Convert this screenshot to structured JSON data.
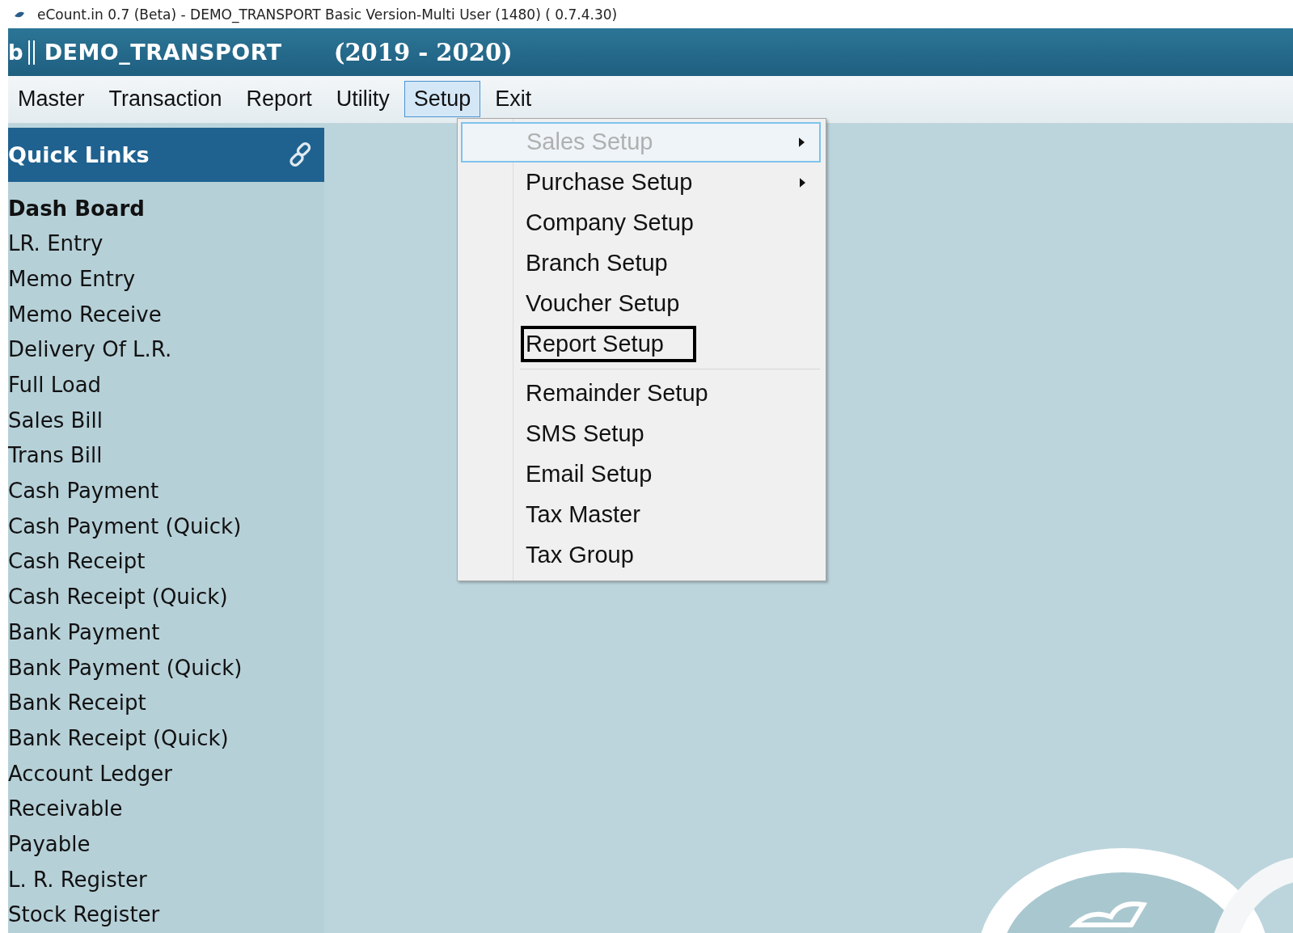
{
  "window": {
    "title": "eCount.in 0.7 (Beta) - DEMO_TRANSPORT Basic Version-Multi User (1480) ( 0.7.4.30)"
  },
  "header": {
    "prefix": "b",
    "company": "DEMO_TRANSPORT",
    "year": "(2019 - 2020)"
  },
  "menu_bar": [
    {
      "label": "Master",
      "selected": false
    },
    {
      "label": "Transaction",
      "selected": false
    },
    {
      "label": "Report",
      "selected": false
    },
    {
      "label": "Utility",
      "selected": false
    },
    {
      "label": "Setup",
      "selected": true
    },
    {
      "label": "Exit",
      "selected": false
    }
  ],
  "setup_menu": [
    {
      "label": "Sales Setup",
      "disabled": true,
      "selected": true,
      "submenu": true,
      "boxed": false,
      "separator_after": false
    },
    {
      "label": "Purchase Setup",
      "disabled": false,
      "selected": false,
      "submenu": true,
      "boxed": false,
      "separator_after": false
    },
    {
      "label": "Company Setup",
      "disabled": false,
      "selected": false,
      "submenu": false,
      "boxed": false,
      "separator_after": false
    },
    {
      "label": "Branch Setup",
      "disabled": false,
      "selected": false,
      "submenu": false,
      "boxed": false,
      "separator_after": false
    },
    {
      "label": "Voucher Setup",
      "disabled": false,
      "selected": false,
      "submenu": false,
      "boxed": false,
      "separator_after": false
    },
    {
      "label": "Report Setup",
      "disabled": false,
      "selected": false,
      "submenu": false,
      "boxed": true,
      "separator_after": true
    },
    {
      "label": "Remainder Setup",
      "disabled": false,
      "selected": false,
      "submenu": false,
      "boxed": false,
      "separator_after": false
    },
    {
      "label": "SMS Setup",
      "disabled": false,
      "selected": false,
      "submenu": false,
      "boxed": false,
      "separator_after": false
    },
    {
      "label": "Email Setup",
      "disabled": false,
      "selected": false,
      "submenu": false,
      "boxed": false,
      "separator_after": false
    },
    {
      "label": "Tax Master",
      "disabled": false,
      "selected": false,
      "submenu": false,
      "boxed": false,
      "separator_after": false
    },
    {
      "label": "Tax Group",
      "disabled": false,
      "selected": false,
      "submenu": false,
      "boxed": false,
      "separator_after": false
    }
  ],
  "quick_links": {
    "title": "Quick Links",
    "items": [
      {
        "label": "Dash Board",
        "selected": true
      },
      {
        "label": "LR. Entry",
        "selected": false
      },
      {
        "label": "Memo Entry",
        "selected": false
      },
      {
        "label": "Memo Receive",
        "selected": false
      },
      {
        "label": "Delivery Of L.R.",
        "selected": false
      },
      {
        "label": "Full Load",
        "selected": false
      },
      {
        "label": "Sales Bill",
        "selected": false
      },
      {
        "label": "Trans Bill",
        "selected": false
      },
      {
        "label": "Cash Payment",
        "selected": false
      },
      {
        "label": "Cash Payment (Quick)",
        "selected": false
      },
      {
        "label": "Cash Receipt",
        "selected": false
      },
      {
        "label": "Cash Receipt (Quick)",
        "selected": false
      },
      {
        "label": "Bank Payment",
        "selected": false
      },
      {
        "label": "Bank Payment (Quick)",
        "selected": false
      },
      {
        "label": "Bank Receipt",
        "selected": false
      },
      {
        "label": "Bank Receipt (Quick)",
        "selected": false
      },
      {
        "label": "Account Ledger",
        "selected": false
      },
      {
        "label": "Receivable",
        "selected": false
      },
      {
        "label": "Payable",
        "selected": false
      },
      {
        "label": "L. R. Register",
        "selected": false
      },
      {
        "label": "Stock Register",
        "selected": false
      }
    ]
  }
}
